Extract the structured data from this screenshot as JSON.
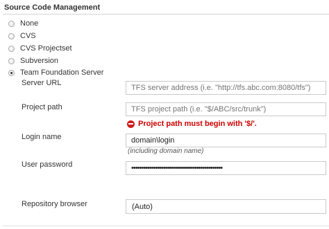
{
  "section": {
    "title": "Source Code Management"
  },
  "scm_options": [
    {
      "label": "None",
      "selected": false
    },
    {
      "label": "CVS",
      "selected": false
    },
    {
      "label": "CVS Projectset",
      "selected": false
    },
    {
      "label": "Subversion",
      "selected": false
    },
    {
      "label": "Team Foundation Server",
      "selected": true
    }
  ],
  "tfs": {
    "server_url": {
      "label": "Server URL",
      "placeholder": "TFS server address (i.e. \"http://tfs.abc.com:8080/tfs\")",
      "value": ""
    },
    "project_path": {
      "label": "Project path",
      "placeholder": "TFS project path (i.e. \"$/ABC/src/trunk\")",
      "value": "",
      "error": "Project path must begin with '$/'."
    },
    "login_name": {
      "label": "Login name",
      "value": "domain\\login",
      "help": "(including domain name)"
    },
    "user_password": {
      "label": "User password",
      "value": "••••••••••••••••••••••••••••••••••••••••••••••"
    },
    "repository_browser": {
      "label": "Repository browser",
      "value": "(Auto)"
    }
  },
  "colors": {
    "error": "#cc0000",
    "border": "#c9c9c9",
    "text": "#333333"
  }
}
